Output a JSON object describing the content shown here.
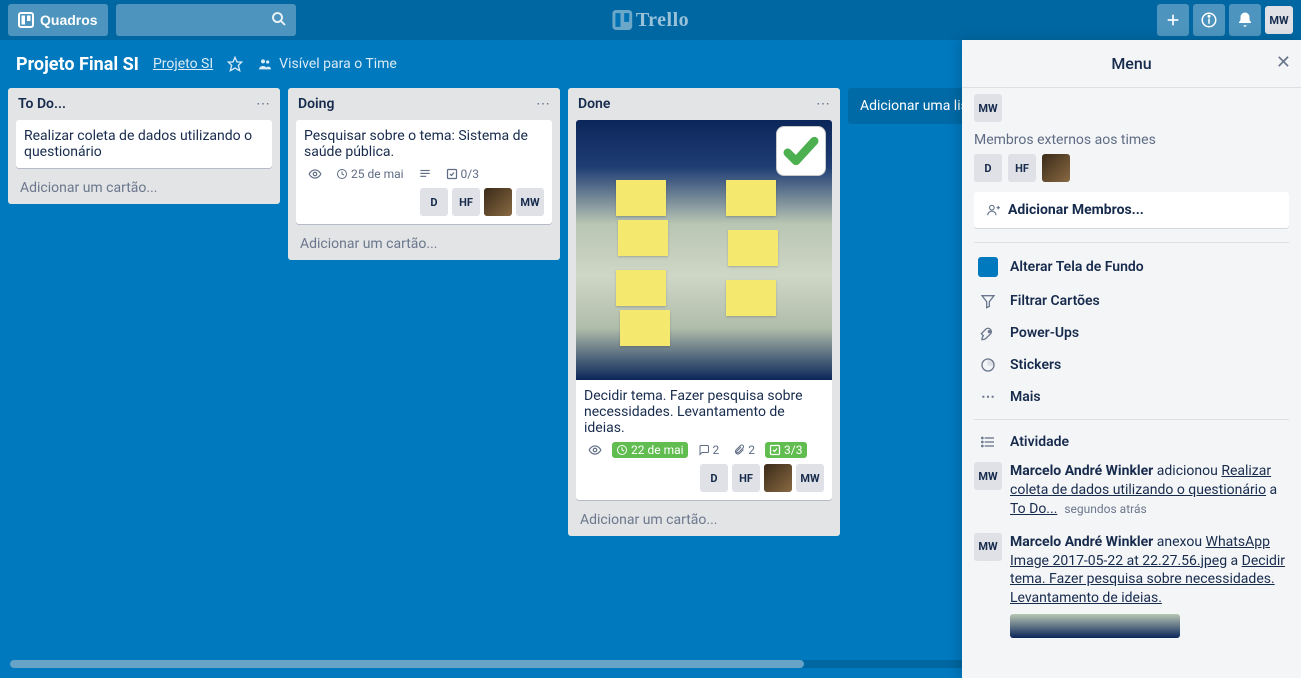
{
  "header": {
    "boards_button": "Quadros",
    "user_initials": "MW"
  },
  "logo_text": "Trello",
  "board_header": {
    "title": "Projeto Final SI",
    "team": "Projeto SI",
    "visibility": "Visível para o Time"
  },
  "lists": [
    {
      "title": "To Do...",
      "cards": [
        {
          "text": "Realizar coleta de dados utilizando o questionário"
        }
      ],
      "add_card": "Adicionar um cartão..."
    },
    {
      "title": "Doing",
      "cards": [
        {
          "text": "Pesquisar sobre o tema: Sistema de saúde pública.",
          "due": "25 de mai",
          "checklist": "0/3",
          "members": [
            "D",
            "HF",
            "img",
            "MW"
          ]
        }
      ],
      "add_card": "Adicionar um cartão..."
    },
    {
      "title": "Done",
      "cards": [
        {
          "has_cover": true,
          "has_sticker": true,
          "text": "Decidir tema. Fazer pesquisa sobre necessidades. Levantamento de ideias.",
          "due": "22 de mai",
          "due_green": true,
          "comments": "2",
          "attachments": "2",
          "checklist": "3/3",
          "checklist_green": true,
          "members": [
            "D",
            "HF",
            "img",
            "MW"
          ]
        }
      ],
      "add_card": "Adicionar um cartão..."
    }
  ],
  "add_list": "Adicionar uma lista...",
  "menu": {
    "title": "Menu",
    "members_external": "Membros externos aos times",
    "team_members": [
      "MW"
    ],
    "external_members": [
      "D",
      "HF",
      "img"
    ],
    "add_members": "Adicionar Membros...",
    "items": {
      "background": "Alterar Tela de Fundo",
      "filter": "Filtrar Cartões",
      "powerups": "Power-Ups",
      "stickers": "Stickers",
      "more": "Mais"
    },
    "activity_label": "Atividade",
    "activity": [
      {
        "avatar": "MW",
        "name": "Marcelo André Winkler",
        "verb": " adicionou ",
        "link1": "Realizar coleta de dados utilizando o questionário",
        "middle": " a ",
        "link2": "To Do...",
        "when": "segundos atrás"
      },
      {
        "avatar": "MW",
        "name": "Marcelo André Winkler",
        "verb": " anexou ",
        "link1": "WhatsApp Image 2017-05-22 at 22.27.56.jpeg",
        "middle": " a ",
        "link2": "Decidir tema. Fazer pesquisa sobre necessidades. Levantamento de ideias.",
        "has_thumb": true
      }
    ]
  }
}
